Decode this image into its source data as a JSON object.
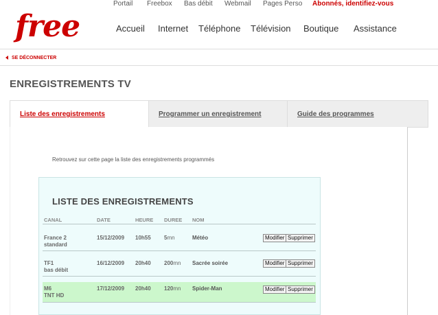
{
  "topnav": {
    "items": [
      "Portail",
      "Freebox",
      "Bas débit",
      "Webmail",
      "Pages Perso"
    ],
    "login": "Abonnés, identifiez-vous"
  },
  "logo": "free",
  "mainnav": [
    "Accueil",
    "Internet",
    "Téléphone",
    "Télévision",
    "Boutique",
    "Assistance"
  ],
  "logout": "SE DÉCONNECTER",
  "page_title": "ENREGISTREMENTS TV",
  "tabs": [
    "Liste des enregistrements",
    "Programmer un enregistrement",
    "Guide des programmes"
  ],
  "intro": "Retrouvez sur cette page la liste des enregistrements programmés",
  "list": {
    "title": "LISTE DES ENREGISTREMENTS",
    "headers": [
      "CANAL",
      "DATE",
      "HEURE",
      "DUREE",
      "NOM"
    ],
    "rows": [
      {
        "canal": "France 2",
        "canal_sub": "standard",
        "date": "15/12/2009",
        "heure": "10h55",
        "duree": "5",
        "duree_unit": "mn",
        "nom": "Météo"
      },
      {
        "canal": "TF1",
        "canal_sub": "bas débit",
        "date": "16/12/2009",
        "heure": "20h40",
        "duree": "200",
        "duree_unit": "mn",
        "nom": "Sacrée soirée"
      },
      {
        "canal": "M6",
        "canal_sub": "TNT HD",
        "date": "17/12/2009",
        "heure": "20h40",
        "duree": "120",
        "duree_unit": "mn",
        "nom": "Spider-Man"
      }
    ],
    "modify_label": "Modifier",
    "delete_label": "Supprimer"
  },
  "colors": {
    "brand": "#cc0000",
    "highlight_row": "#ccf7cc",
    "list_bg": "#eefcfc"
  }
}
